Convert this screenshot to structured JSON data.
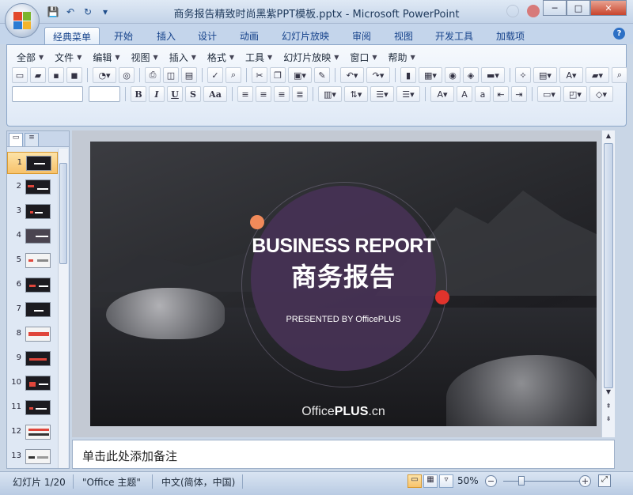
{
  "window": {
    "title": "商务报告精致时尚黑紫PPT模板.pptx - Microsoft PowerPoint",
    "controls": {
      "minimize": "─",
      "maximize": "□",
      "close": "✕"
    }
  },
  "qat": {
    "save": "💾",
    "undo": "↶",
    "redo": "↻",
    "more": "▾"
  },
  "ribbon_tabs": [
    "经典菜单",
    "开始",
    "插入",
    "设计",
    "动画",
    "幻灯片放映",
    "审阅",
    "视图",
    "开发工具",
    "加载项"
  ],
  "help": "?",
  "menu": [
    "全部",
    "文件",
    "编辑",
    "视图",
    "插入",
    "格式",
    "工具",
    "幻灯片放映",
    "窗口",
    "帮助"
  ],
  "format_buttons": {
    "bold": "B",
    "italic": "I",
    "underline": "U",
    "shadow": "S",
    "case": "Aa"
  },
  "left_panel": {
    "tab_slides": "▭",
    "tab_outline": "≡",
    "thumbnails": [
      "1",
      "2",
      "3",
      "4",
      "5",
      "6",
      "7",
      "8",
      "9",
      "10",
      "11",
      "12",
      "13"
    ],
    "selected_index": 1
  },
  "slide": {
    "title": "BUSINESS REPORT",
    "title_cn": "商务报告",
    "subtitle": "PRESENTED BY OfficePLUS",
    "logo_prefix": "Office",
    "logo_bold": "PLUS",
    "logo_suffix": ".cn",
    "colors": {
      "circle": "#46325a",
      "orange_dot": "#f08a5a",
      "red_dot": "#e0332c"
    }
  },
  "notes": {
    "placeholder": "单击此处添加备注"
  },
  "status": {
    "slide_info": "幻灯片 1/20",
    "theme": "\"Office 主题\"",
    "language": "中文(简体，中国)",
    "zoom": "50%",
    "zoom_level": 0.5
  }
}
